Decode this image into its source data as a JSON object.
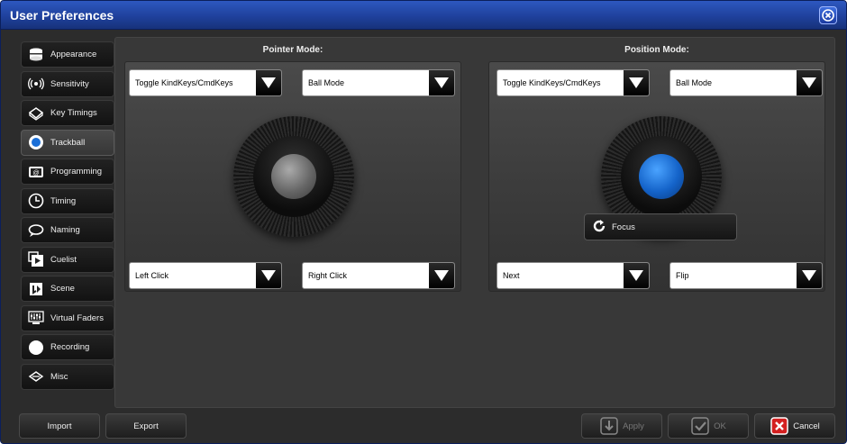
{
  "window": {
    "title": "User Preferences"
  },
  "sidebar": {
    "items": [
      {
        "label": "Appearance",
        "icon": "appearance-icon"
      },
      {
        "label": "Sensitivity",
        "icon": "sensitivity-icon"
      },
      {
        "label": "Key Timings",
        "icon": "key-timings-icon"
      },
      {
        "label": "Trackball",
        "icon": "trackball-icon",
        "active": true
      },
      {
        "label": "Programming",
        "icon": "programming-icon"
      },
      {
        "label": "Timing",
        "icon": "clock-icon"
      },
      {
        "label": "Naming",
        "icon": "speech-bubble-icon"
      },
      {
        "label": "Cuelist",
        "icon": "cuelist-icon"
      },
      {
        "label": "Scene",
        "icon": "scene-icon"
      },
      {
        "label": "Virtual Faders",
        "icon": "virtual-faders-icon"
      },
      {
        "label": "Recording",
        "icon": "record-icon"
      },
      {
        "label": "Misc",
        "icon": "misc-icon"
      }
    ]
  },
  "pointer": {
    "title": "Pointer Mode:",
    "top_left": "Toggle KindKeys/CmdKeys",
    "top_right": "Ball Mode",
    "bottom_left": "Left Click",
    "bottom_right": "Right Click",
    "ball_color": "#7a7a7a"
  },
  "position": {
    "title": "Position Mode:",
    "top_left": "Toggle KindKeys/CmdKeys",
    "top_right": "Ball Mode",
    "bottom_left": "Next",
    "bottom_right": "Flip",
    "ball_color": "#1a6fd8",
    "focus_label": "Focus"
  },
  "buttons": {
    "import": "Import",
    "export": "Export",
    "apply": "Apply",
    "ok": "OK",
    "cancel": "Cancel"
  },
  "colors": {
    "title_bar": "#2350b0",
    "cancel_icon": "#d42020"
  }
}
